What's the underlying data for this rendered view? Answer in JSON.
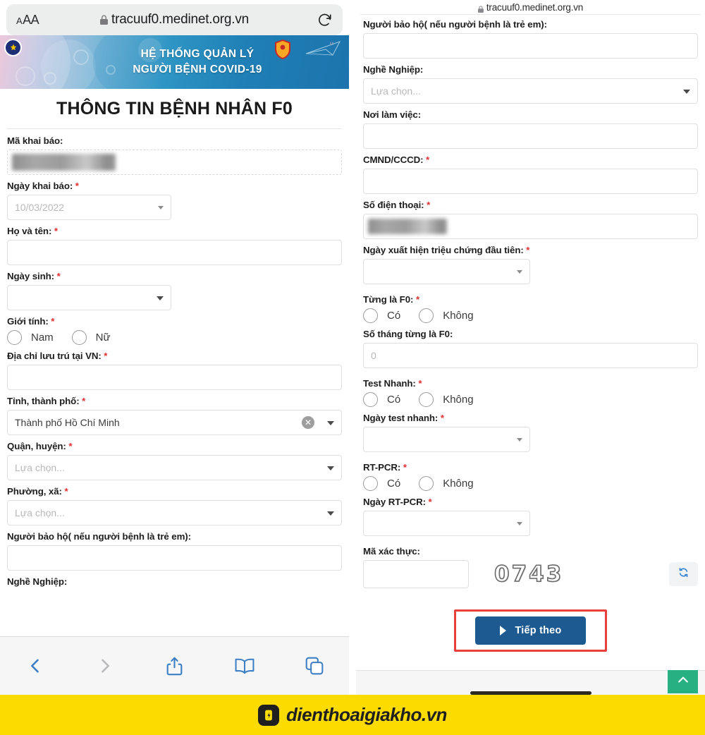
{
  "browser": {
    "url": "tracuuf0.medinet.org.vn",
    "text_size_label": "AA",
    "reload_icon": "reload-icon",
    "lock_icon": "lock-icon",
    "toolbar": [
      {
        "name": "back-button",
        "icon": "chevron-left-icon"
      },
      {
        "name": "forward-button",
        "icon": "chevron-right-icon"
      },
      {
        "name": "share-button",
        "icon": "share-icon"
      },
      {
        "name": "bookmarks-button",
        "icon": "book-icon"
      },
      {
        "name": "tabs-button",
        "icon": "tabs-icon"
      }
    ]
  },
  "banner": {
    "line1": "HỆ THỐNG QUẢN LÝ",
    "line2": "NGƯỜI BỆNH COVID-19"
  },
  "page": {
    "title": "THÔNG TIN BỆNH NHÂN F0"
  },
  "left_form": {
    "ma_khai_bao": {
      "label": "Mã khai báo:",
      "required": false,
      "value": ""
    },
    "ngay_khai_bao": {
      "label": "Ngày khai báo:",
      "required": true,
      "value": "10/03/2022"
    },
    "ho_va_ten": {
      "label": "Họ và tên:",
      "required": true,
      "value": ""
    },
    "ngay_sinh": {
      "label": "Ngày sinh:",
      "required": true,
      "value": ""
    },
    "gioi_tinh": {
      "label": "Giới tính:",
      "required": true,
      "options": [
        "Nam",
        "Nữ"
      ]
    },
    "dia_chi": {
      "label": "Địa chỉ lưu trú tại VN:",
      "required": true,
      "value": ""
    },
    "tinh_thanh_pho": {
      "label": "Tỉnh, thành phố:",
      "required": true,
      "value": "Thành phố Hồ Chí Minh"
    },
    "quan_huyen": {
      "label": "Quận, huyện:",
      "required": true,
      "placeholder": "Lựa chọn..."
    },
    "phuong_xa": {
      "label": "Phường, xã:",
      "required": true,
      "placeholder": "Lựa chọn..."
    },
    "nguoi_bao_ho": {
      "label": "Người bảo hộ( nếu người bệnh là trẻ em):",
      "required": false,
      "value": ""
    },
    "nghe_nghiep": {
      "label": "Nghề Nghiệp:",
      "required": false
    }
  },
  "right_form": {
    "nguoi_bao_ho": {
      "label": "Người bảo hộ( nếu người bệnh là trẻ em):",
      "required": false,
      "value": ""
    },
    "nghe_nghiep": {
      "label": "Nghề Nghiệp:",
      "required": false,
      "placeholder": "Lựa chọn..."
    },
    "noi_lam_viec": {
      "label": "Nơi làm việc:",
      "required": false,
      "value": ""
    },
    "cmnd_cccd": {
      "label": "CMND/CCCD:",
      "required": true,
      "value": ""
    },
    "so_dien_thoai": {
      "label": "Số điện thoại:",
      "required": true,
      "value": ""
    },
    "ngay_trieu_chung": {
      "label": "Ngày xuất hiện triệu chứng đầu tiên:",
      "required": true,
      "value": ""
    },
    "tung_la_f0": {
      "label": "Từng là F0:",
      "required": true,
      "options": [
        "Có",
        "Không"
      ]
    },
    "so_thang_f0": {
      "label": "Số tháng từng là F0:",
      "required": false,
      "placeholder": "0"
    },
    "test_nhanh": {
      "label": "Test Nhanh:",
      "required": true,
      "options": [
        "Có",
        "Không"
      ]
    },
    "ngay_test_nhanh": {
      "label": "Ngày test nhanh:",
      "required": true,
      "value": ""
    },
    "rt_pcr": {
      "label": "RT-PCR:",
      "required": true,
      "options": [
        "Có",
        "Không"
      ]
    },
    "ngay_rt_pcr": {
      "label": "Ngày RT-PCR:",
      "required": true,
      "value": ""
    },
    "ma_xac_thuc": {
      "label": "Mã xác thực:",
      "required": false,
      "value": ""
    },
    "captcha_code": "0743",
    "captcha_refresh_icon": "refresh-icon",
    "submit_label": "Tiếp theo",
    "scroll_top_icon": "chevron-up-icon"
  },
  "footer": {
    "brand": "dienthoaigiakho.vn",
    "logo_icon": "phone-app-icon"
  },
  "colors": {
    "accent_blue": "#1c5a91",
    "highlight_red": "#e8403a",
    "footer_yellow": "#fcdb00",
    "scroll_green": "#27b082",
    "required_red": "#e03131",
    "banner_blue": "#2e95c4"
  }
}
